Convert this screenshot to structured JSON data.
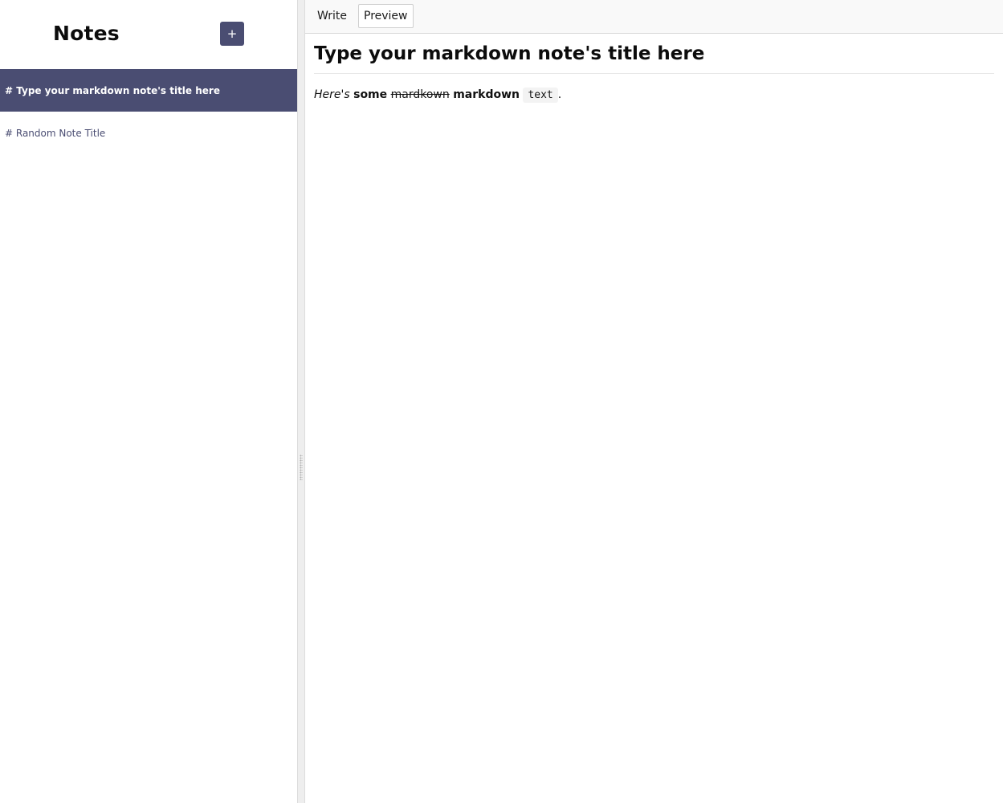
{
  "sidebar": {
    "title": "Notes",
    "add_button_label": "+",
    "notes": [
      {
        "label": "# Type your markdown note's title here",
        "selected": true
      },
      {
        "label": "# Random Note Title",
        "selected": false
      }
    ]
  },
  "editor": {
    "tabs": [
      {
        "label": "Write",
        "active": false
      },
      {
        "label": "Preview",
        "active": true
      }
    ],
    "preview": {
      "title": "Type your markdown note's title here",
      "body": {
        "emphasis": "Here's",
        "strong_1": "some",
        "strikethrough": "mardkown",
        "strong_2": "markdown",
        "code": "text",
        "end": "."
      }
    }
  },
  "colors": {
    "accent": "#4a4d72",
    "selected_item_text": "#ffffff",
    "tab_bar_bg": "#f9f9f9",
    "gutter_bg": "#eeeeee"
  }
}
